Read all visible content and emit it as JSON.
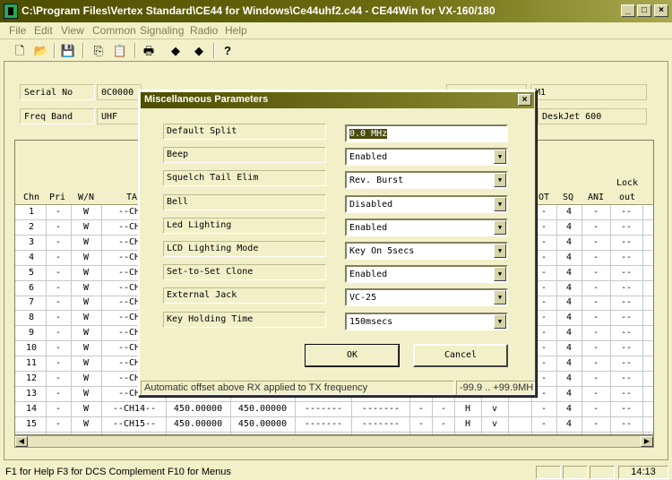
{
  "window": {
    "title": "C:\\Program Files\\Vertex Standard\\CE44 for Windows\\Ce44uhf2.c44 - CE44Win for VX-160/180",
    "minimize": "_",
    "maximize": "□",
    "close": "×"
  },
  "menu": [
    "File",
    "Edit",
    "View",
    "Common",
    "Signaling",
    "Radio",
    "Help"
  ],
  "info": {
    "serial_label": "Serial No",
    "serial_value": "0C0000",
    "freq_label": "Freq Band",
    "freq_value": "UHF",
    "model_suffix": "M1",
    "printer": "DeskJet 600"
  },
  "grid": {
    "headers": {
      "chn": "Chn",
      "pri": "Pri",
      "wn": "W/N",
      "tag": "TA",
      "ot": "OT",
      "sq": "SQ",
      "ani": "ANI",
      "lock_top": "Lock",
      "lock_bottom": "out"
    },
    "rows": [
      {
        "chn": "1",
        "pri": "-",
        "wn": "W",
        "tag": "--CH0"
      },
      {
        "chn": "2",
        "pri": "-",
        "wn": "W",
        "tag": "--CH0"
      },
      {
        "chn": "3",
        "pri": "-",
        "wn": "W",
        "tag": "--CH0"
      },
      {
        "chn": "4",
        "pri": "-",
        "wn": "W",
        "tag": "--CH0"
      },
      {
        "chn": "5",
        "pri": "-",
        "wn": "W",
        "tag": "--CH0"
      },
      {
        "chn": "6",
        "pri": "-",
        "wn": "W",
        "tag": "--CH0"
      },
      {
        "chn": "7",
        "pri": "-",
        "wn": "W",
        "tag": "--CH0"
      },
      {
        "chn": "8",
        "pri": "-",
        "wn": "W",
        "tag": "--CH0"
      },
      {
        "chn": "9",
        "pri": "-",
        "wn": "W",
        "tag": "--CH0"
      },
      {
        "chn": "10",
        "pri": "-",
        "wn": "W",
        "tag": "--CH1"
      },
      {
        "chn": "11",
        "pri": "-",
        "wn": "W",
        "tag": "--CH1"
      },
      {
        "chn": "12",
        "pri": "-",
        "wn": "W",
        "tag": "--CH1"
      },
      {
        "chn": "13",
        "pri": "-",
        "wn": "W",
        "tag": "--CH1"
      }
    ],
    "right_cols": {
      "ot": "-",
      "sq": "4",
      "ani": "-",
      "lock": "--"
    },
    "full_rows": [
      {
        "chn": "14",
        "pri": "-",
        "wn": "W",
        "tag": "--CH14--",
        "rx": "450.00000",
        "tx": "450.00000",
        "c1": "-------",
        "c2": "-------",
        "d1": "-",
        "d2": "-",
        "pw": "H",
        "v": "v",
        "ot": "-",
        "sq": "4",
        "ani": "-",
        "lock": "--"
      },
      {
        "chn": "15",
        "pri": "-",
        "wn": "W",
        "tag": "--CH15--",
        "rx": "450.00000",
        "tx": "450.00000",
        "c1": "-------",
        "c2": "-------",
        "d1": "-",
        "d2": "-",
        "pw": "H",
        "v": "v",
        "ot": "-",
        "sq": "4",
        "ani": "-",
        "lock": "--"
      }
    ]
  },
  "dialog": {
    "title": "Miscellaneous Parameters",
    "close": "×",
    "params": [
      {
        "label": "Default Split",
        "value": "0.0    MHz"
      },
      {
        "label": "Beep",
        "value": "Enabled"
      },
      {
        "label": "Squelch Tail Elim",
        "value": "Rev. Burst"
      },
      {
        "label": "Bell",
        "value": "Disabled"
      },
      {
        "label": "Led Lighting",
        "value": "Enabled"
      },
      {
        "label": "LCD Lighting Mode",
        "value": "Key On 5secs"
      },
      {
        "label": "Set-to-Set Clone",
        "value": "Enabled"
      },
      {
        "label": "External Jack",
        "value": "VC-25"
      },
      {
        "label": "Key Holding Time",
        "value": "150msecs"
      }
    ],
    "ok": "OK",
    "cancel": "Cancel",
    "status": "Automatic offset above RX applied to TX frequency",
    "range": "-99.9 .. +99.9MH:"
  },
  "statusbar": {
    "message": "F1 for Help   F3 for DCS Complement   F10 for Menus",
    "clock": "14:13"
  },
  "colors": {
    "titlebar": "#4d4d00",
    "background": "#f2f0c8",
    "arrow": "#ff4400"
  }
}
